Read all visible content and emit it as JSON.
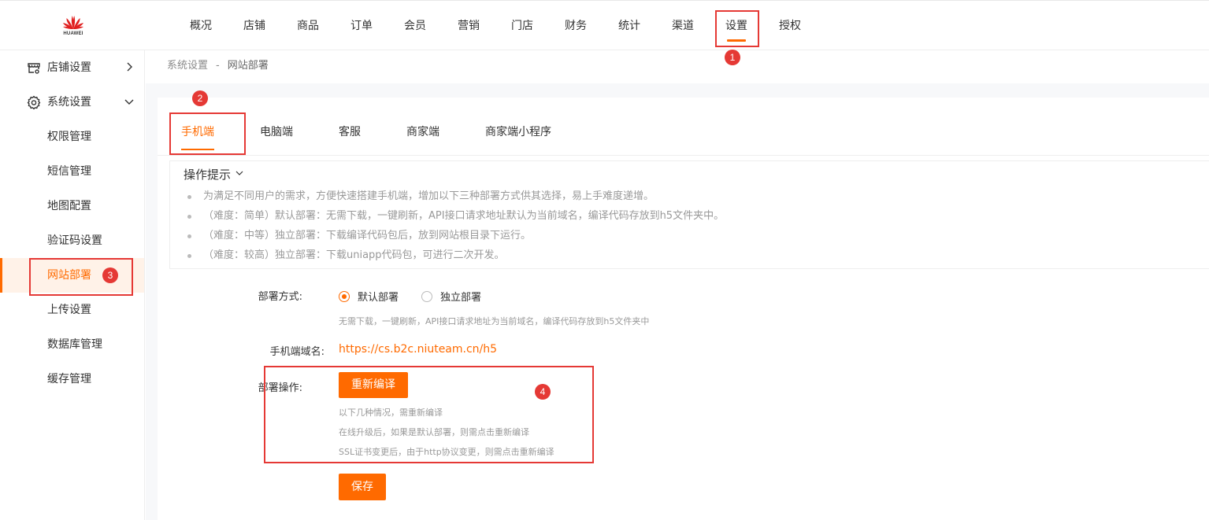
{
  "brand": {
    "logo_text": "HUAWEI",
    "accent": "#ff6a00",
    "annotation_color": "#e53935"
  },
  "nav": {
    "items": [
      "概况",
      "店铺",
      "商品",
      "订单",
      "会员",
      "营销",
      "门店",
      "财务",
      "统计",
      "渠道",
      "设置",
      "授权"
    ],
    "active": "设置"
  },
  "sidebar": {
    "groups": [
      {
        "label": "店铺设置",
        "icon": "store-icon",
        "arrow": "chevron-right-icon"
      },
      {
        "label": "系统设置",
        "icon": "gear-icon",
        "arrow": "chevron-down-icon"
      }
    ],
    "sub_items": [
      "权限管理",
      "短信管理",
      "地图配置",
      "验证码设置",
      "网站部署",
      "上传设置",
      "数据库管理",
      "缓存管理"
    ],
    "active": "网站部署"
  },
  "breadcrumb": {
    "parent": "系统设置",
    "separator": "-",
    "current": "网站部署"
  },
  "tabs": {
    "items": [
      "手机端",
      "电脑端",
      "客服",
      "商家端",
      "商家端小程序"
    ],
    "active": "手机端"
  },
  "tips": {
    "title": "操作提示",
    "items": [
      "为满足不同用户的需求，方便快速搭建手机端，增加以下三种部署方式供其选择，易上手难度递增。",
      "（难度：简单）默认部署：无需下载，一键刷新，API接口请求地址默认为当前域名，编译代码存放到h5文件夹中。",
      "（难度：中等）独立部署：下载编译代码包后，放到网站根目录下运行。",
      "（难度：较高）独立部署：下载uniapp代码包，可进行二次开发。"
    ]
  },
  "form": {
    "deploy_mode_label": "部署方式:",
    "radio_default": "默认部署",
    "radio_standalone": "独立部署",
    "selected": "默认部署",
    "deploy_hint": "无需下载，一键刷新，API接口请求地址为当前域名，编译代码存放到h5文件夹中",
    "domain_label": "手机端域名:",
    "domain_value": "https://cs.b2c.niuteam.cn/h5",
    "ops_label": "部署操作:",
    "recompile_button": "重新编译",
    "ops_hints": [
      "以下几种情况，需重新编译",
      "在线升级后，如果是默认部署，则需点击重新编译",
      "SSL证书变更后，由于http协议变更，则需点击重新编译"
    ],
    "save_button": "保存"
  },
  "annotations": [
    "1",
    "2",
    "3",
    "4"
  ]
}
